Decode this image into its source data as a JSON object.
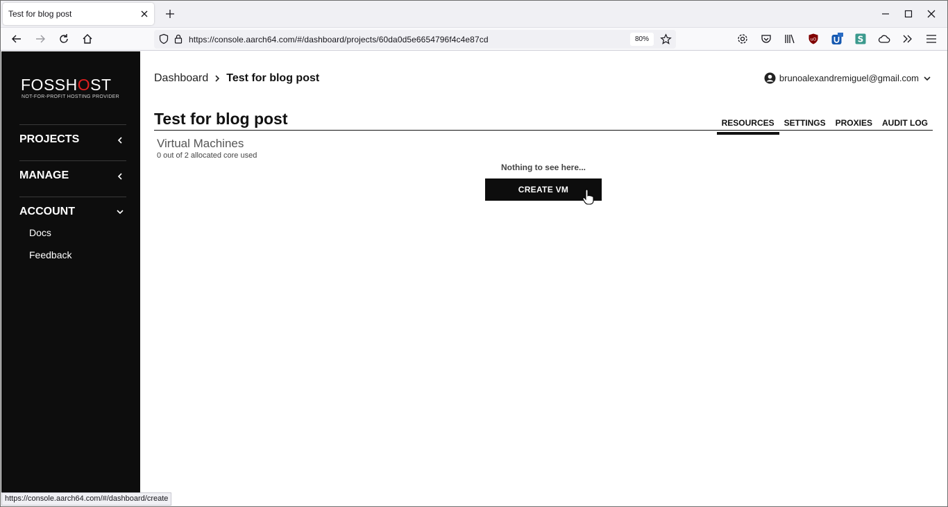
{
  "browser": {
    "tab_title": "Test for blog post",
    "url": "https://console.aarch64.com/#/dashboard/projects/60da0d5e6654796f4c4e87cd",
    "zoom": "80%",
    "status_url": "https://console.aarch64.com/#/dashboard/create",
    "extension_badge": "1"
  },
  "sidebar": {
    "logo_text_1": "FOSSH",
    "logo_text_o": "O",
    "logo_text_2": "ST",
    "logo_sub": "NOT-FOR-PROFIT HOSTING PROVIDER",
    "sections": [
      {
        "label": "PROJECTS",
        "expanded": false
      },
      {
        "label": "MANAGE",
        "expanded": false
      },
      {
        "label": "ACCOUNT",
        "expanded": true
      }
    ],
    "account_items": [
      "Docs",
      "Feedback"
    ]
  },
  "header": {
    "breadcrumb_root": "Dashboard",
    "breadcrumb_current": "Test for blog post",
    "user_email": "brunoalexandremiguel@gmail.com"
  },
  "main": {
    "title": "Test for blog post",
    "tabs": [
      {
        "label": "RESOURCES",
        "active": true
      },
      {
        "label": "SETTINGS",
        "active": false
      },
      {
        "label": "PROXIES",
        "active": false
      },
      {
        "label": "AUDIT LOG",
        "active": false
      }
    ],
    "section_title": "Virtual Machines",
    "section_sub": "0 out of 2 allocated core used",
    "empty_message": "Nothing to see here...",
    "create_button": "CREATE VM"
  }
}
